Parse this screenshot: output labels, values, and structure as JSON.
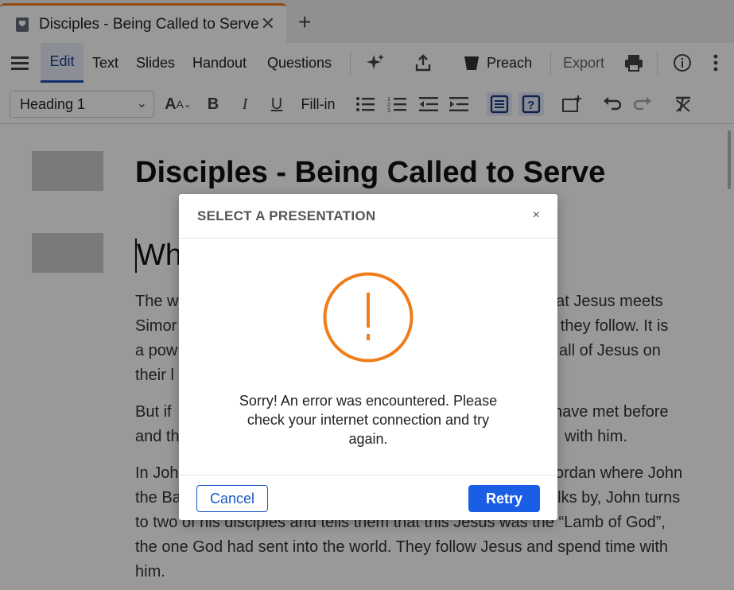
{
  "tab": {
    "title": "Disciples - Being Called to Serve",
    "close": "✕",
    "new": "+"
  },
  "menu": {
    "edit": "Edit",
    "text": "Text",
    "slides": "Slides",
    "handout": "Handout",
    "questions": "Questions",
    "preach": "Preach",
    "export": "Export"
  },
  "format": {
    "style": "Heading 1",
    "fill_in": "Fill-in"
  },
  "document": {
    "title": "Disciples - Being Called to Serve",
    "subheading": "Wh",
    "paragraphs": [
      [
        "The w",
        "hat Jesus meets",
        "Simor",
        "nd they follow. It is",
        "a pow",
        "all of Jesus on",
        "their l"
      ],
      [
        "But if",
        "have met before",
        "and th",
        "with him."
      ],
      [
        "In Joh",
        "ordan where John",
        "the Ba",
        "alks by, John turns"
      ]
    ],
    "para3_line3": "to two of his disciples and tells them that this Jesus was the “Lamb of God”,",
    "para3_line4": "the one God had sent into the world. They follow Jesus and spend time with",
    "para3_line5": "him."
  },
  "dialog": {
    "title": "SELECT A PRESENTATION",
    "close": "×",
    "message": "Sorry! An error was encountered. Please check your internet connection and try again.",
    "cancel": "Cancel",
    "retry": "Retry",
    "icon": "warning-icon",
    "accent": "#f07c1a"
  },
  "colors": {
    "tab_accent": "#f07c1a",
    "primary": "#1a5ee6"
  }
}
